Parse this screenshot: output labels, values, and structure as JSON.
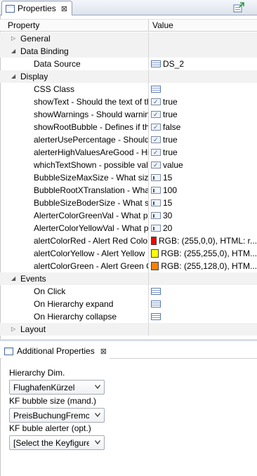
{
  "view": {
    "title": "Properties",
    "close_glyph": "⊠",
    "pin_icon": "pin-icon"
  },
  "table": {
    "col_property": "Property",
    "col_value": "Value",
    "rows": [
      {
        "kind": "cat",
        "expanded": false,
        "name": "General",
        "value": "",
        "icon": ""
      },
      {
        "kind": "cat",
        "expanded": true,
        "name": "Data Binding",
        "value": "",
        "icon": ""
      },
      {
        "kind": "prop",
        "name": "Data Source",
        "value": "DS_2",
        "icon": "list-icon"
      },
      {
        "kind": "cat",
        "expanded": true,
        "name": "Display",
        "value": "",
        "icon": ""
      },
      {
        "kind": "prop",
        "name": "CSS Class",
        "value": "",
        "icon": "list-icon"
      },
      {
        "kind": "prop",
        "name": "showText - Should the text of th",
        "value": "true",
        "icon": "boolean-icon"
      },
      {
        "kind": "prop",
        "name": "showWarnings - Should warnin",
        "value": "true",
        "icon": "boolean-icon"
      },
      {
        "kind": "prop",
        "name": "showRootBubble - Defines if th",
        "value": "false",
        "icon": "boolean-icon"
      },
      {
        "kind": "prop",
        "name": "alerterUsePercentage - Should",
        "value": "true",
        "icon": "boolean-icon"
      },
      {
        "kind": "prop",
        "name": "alerterHighValuesAreGood - Hi",
        "value": "true",
        "icon": "boolean-icon"
      },
      {
        "kind": "prop",
        "name": "whichTextShown - possible val",
        "value": "value",
        "icon": "boolean-icon"
      },
      {
        "kind": "prop",
        "name": "BubbleSizeMaxSize - What size",
        "value": "15",
        "icon": "number-icon"
      },
      {
        "kind": "prop",
        "name": "BubbleRootXTranslation - What",
        "value": "100",
        "icon": "number-icon"
      },
      {
        "kind": "prop",
        "name": "BubbleSizeBoderSize - What siz",
        "value": "15",
        "icon": "number-icon"
      },
      {
        "kind": "prop",
        "name": "AlerterColorGreenVal - What pe",
        "value": "30",
        "icon": "number-icon"
      },
      {
        "kind": "prop",
        "name": "AlerterColorYellowVal - What p",
        "value": "20",
        "icon": "number-icon"
      },
      {
        "kind": "prop",
        "name": "alertColorRed - Alert Red Color",
        "value": "RGB: (255,0,0),  HTML: r...",
        "icon": "color-swatch",
        "color": "#ff0000"
      },
      {
        "kind": "prop",
        "name": "alertColorYellow - Alert Yellow",
        "value": "RGB: (255,255,0),  HTM...",
        "icon": "color-swatch",
        "color": "#ffff00"
      },
      {
        "kind": "prop",
        "name": "alertColorGreen - Alert Green C",
        "value": "RGB: (255,128,0),  HTM...",
        "icon": "color-swatch",
        "color": "#ff8000"
      },
      {
        "kind": "cat",
        "expanded": true,
        "name": "Events",
        "value": "",
        "icon": ""
      },
      {
        "kind": "prop",
        "name": "On Click",
        "value": "",
        "icon": "list-icon"
      },
      {
        "kind": "prop",
        "name": "On Hierarchy expand",
        "value": "",
        "icon": "list-icon"
      },
      {
        "kind": "prop",
        "name": "On Hierarchy collapse",
        "value": "",
        "icon": "list-icon"
      },
      {
        "kind": "cat",
        "expanded": false,
        "name": "Layout",
        "value": "",
        "icon": ""
      }
    ]
  },
  "additional": {
    "title": "Additional Properties",
    "close_glyph": "⊠",
    "hierarchy_label": "Hierarchy Dim.",
    "hierarchy_value": "FlughafenKürzel",
    "kf_size_label": "KF bubble size (mand.)",
    "kf_size_value": "PreisBuchungFremc",
    "kf_alert_label": "KF buble alerter (opt.)",
    "kf_alert_value": "[Select the Keyfigure"
  }
}
